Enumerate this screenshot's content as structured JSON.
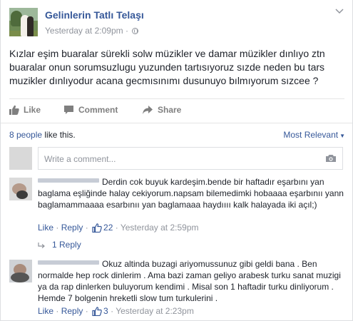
{
  "post": {
    "page_name": "Gelinlerin Tatlı Telaşı",
    "timestamp": "Yesterday at 2:09pm",
    "separator": "·",
    "text": "Kızlar eşim buaralar sürekli solw müzikler ve damar müzikler dınlıyo ztn buaralar onun sorumsuzlugu yuzunden tartısıyoruz sızde neden bu tars muzikler dınlıyodur acana gecmısınımı dusunuyo bılmıyorum sızcee ?"
  },
  "actions": {
    "like": "Like",
    "comment": "Comment",
    "share": "Share"
  },
  "likes": {
    "count": "8 people",
    "suffix": " like this.",
    "sort": "Most Relevant"
  },
  "compose": {
    "placeholder": "Write a comment..."
  },
  "comments": [
    {
      "text": "Derdin cok buyuk kardeşim.bende bir haftadır eşarbını yan baglama eşliğinde halay cekiyorum.napsam bilemedimki hobaaaa eşarbınıı yann baglamammaaaa esarbınıı yan baglamaaa haydıııı kalk halayada iki açıl;)",
      "like_link": "Like",
      "reply_link": "Reply",
      "likes": "22",
      "time": "Yesterday at 2:59pm",
      "replies": "1 Reply"
    },
    {
      "text": "Okuz altinda buzagi ariyomussunuz gibi geldi bana . Ben normalde hep rock dinlerim . Ama bazi zaman geliyo arabesk turku sanat muzigi ya da rap dinlerken buluyorum kendimi . Misal son 1 haftadir turku dinliyorum . Hemde 7 bolgenin hreketli slow tum turkulerini .",
      "like_link": "Like",
      "reply_link": "Reply",
      "likes": "3",
      "time": "Yesterday at 2:23pm"
    }
  ],
  "icons": {
    "globe": "globe-icon",
    "chevron": "chevron-down-icon",
    "like": "thumbs-up-icon",
    "comment": "speech-bubble-icon",
    "share": "share-arrow-icon",
    "camera": "camera-icon",
    "reply": "reply-arrow-icon"
  },
  "colors": {
    "link": "#365899",
    "meta": "#90949c",
    "text": "#1d2129"
  }
}
